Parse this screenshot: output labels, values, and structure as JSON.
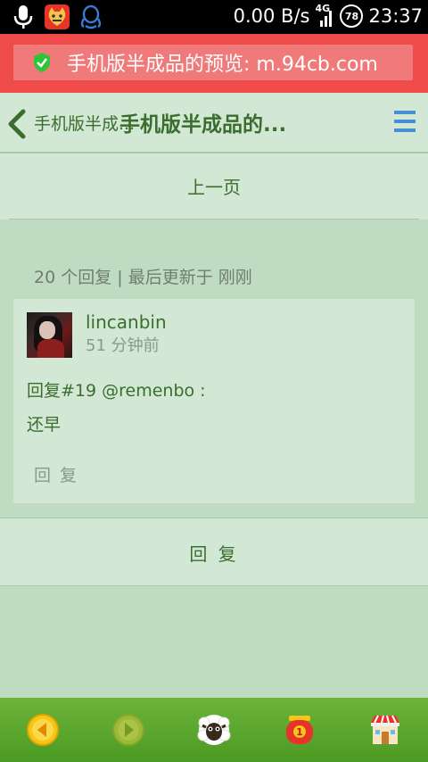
{
  "status_bar": {
    "network_speed": "0.00 B/s",
    "signal_type": "4G",
    "battery_level": "78",
    "time": "23:37"
  },
  "url_bar": {
    "text": "手机版半成品的预览: m.94cb.com"
  },
  "header": {
    "back_label": "手机版半成...",
    "title": "手机版半成品的..."
  },
  "pagination": {
    "prev_label": "上一页"
  },
  "thread_meta": "20 个回复 | 最后更新于 刚刚",
  "post": {
    "username": "lincanbin",
    "time": "51 分钟前",
    "reply_ref": "回复#19 @remenbo :",
    "content": "还早",
    "reply_label": "回 复"
  },
  "reply_button_label": "回 复",
  "colors": {
    "accent_green": "#3b6e2e",
    "url_bar_red": "#ef4b4b",
    "menu_blue": "#4a8ed9",
    "bottom_bar_green": "#5aa82d"
  },
  "icons": {
    "status_left": [
      "microphone-icon",
      "cat-app-icon",
      "qq-icon"
    ],
    "bottom_bar": [
      "back-arrow-icon",
      "forward-arrow-icon",
      "sheep-icon",
      "red-envelope-icon",
      "shop-icon"
    ],
    "red_envelope_badge": "1"
  }
}
